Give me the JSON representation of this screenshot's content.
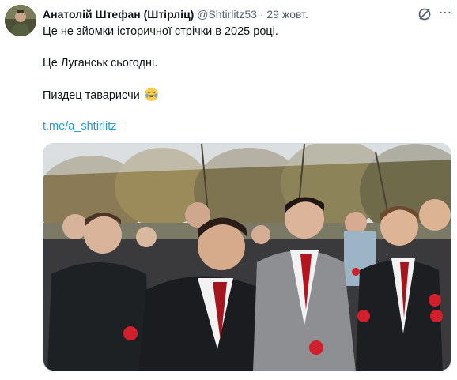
{
  "author": {
    "display_name": "Анатолій Штефан (Штірліц)",
    "handle": "@Shtirlitz53",
    "separator": "·",
    "date": "29 жовт."
  },
  "post": {
    "line1": "Це не зйомки історичної стрічки в 2025 році.",
    "line2": "Це Луганськ сьогодні.",
    "line3": "Пиздец таварисчи",
    "emoji": "face-with-tears-of-joy",
    "link": "t.me/a_shtirlitz"
  },
  "actions": {
    "grok_icon": "grok-icon",
    "more_icon": "more-icon",
    "more_glyph": "⋯"
  },
  "colors": {
    "link": "#1d9bf0",
    "secondary_text": "#536471"
  }
}
